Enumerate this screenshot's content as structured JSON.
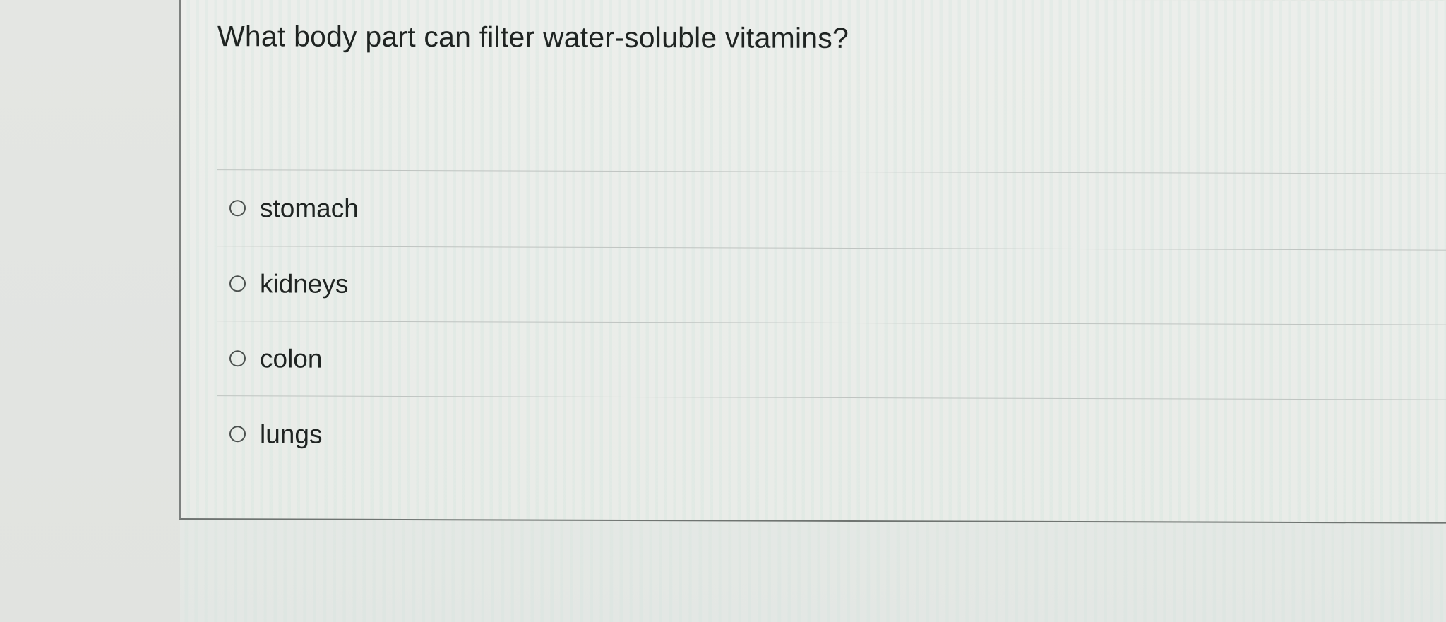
{
  "quiz": {
    "question": "What body part can filter water-soluble vitamins?",
    "options": [
      {
        "label": "stomach",
        "selected": false
      },
      {
        "label": "kidneys",
        "selected": false
      },
      {
        "label": "colon",
        "selected": false
      },
      {
        "label": "lungs",
        "selected": false
      }
    ]
  }
}
